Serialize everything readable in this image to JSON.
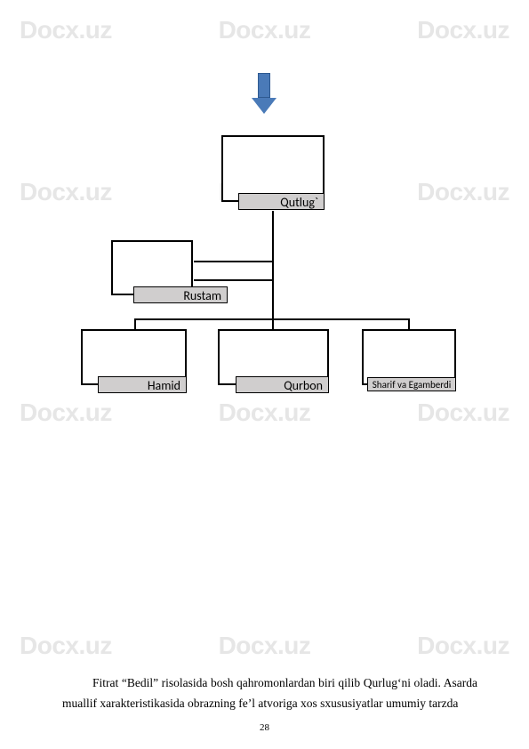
{
  "watermark": "Docx.uz",
  "chart_data": {
    "type": "tree",
    "nodes": {
      "root": {
        "label": "Qutlug`"
      },
      "rustam": {
        "label": "Rustam"
      },
      "hamid": {
        "label": "Hamid"
      },
      "qurbon": {
        "label": "Qurbon"
      },
      "sharif": {
        "label": "Sharif va Egamberdi"
      }
    },
    "edges": [
      [
        "root",
        "rustam"
      ],
      [
        "root",
        "hamid"
      ],
      [
        "root",
        "qurbon"
      ],
      [
        "root",
        "sharif"
      ]
    ]
  },
  "body": {
    "paragraph": "Fitrat “Bedil” risolasida bosh qahromonlardan biri qilib Qurlug‘ni oladi. Asarda muallif xarakteristikasida obrazning fe’l atvoriga xos sxususiyatlar umumiy tarzda"
  },
  "page_number": "28"
}
